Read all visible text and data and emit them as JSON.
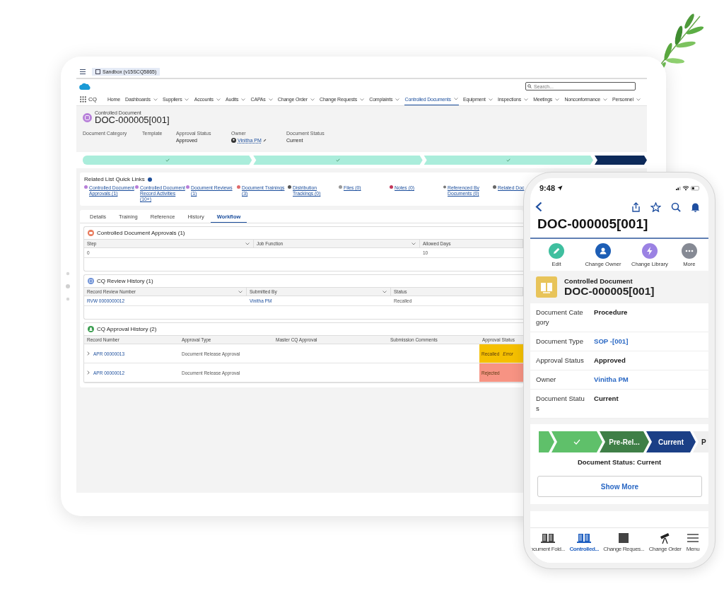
{
  "tablet": {
    "app_tab": "Sandbox (v15SCQ5865)",
    "app_name": "CQ",
    "search": {
      "placeholder": "Search..."
    },
    "nav": [
      {
        "label": "Home",
        "menu": false,
        "selected": false
      },
      {
        "label": "Dashboards",
        "menu": true,
        "selected": false
      },
      {
        "label": "Suppliers",
        "menu": true,
        "selected": false
      },
      {
        "label": "Accounts",
        "menu": true,
        "selected": false
      },
      {
        "label": "Audits",
        "menu": true,
        "selected": false
      },
      {
        "label": "CAPAs",
        "menu": true,
        "selected": false
      },
      {
        "label": "Change Order",
        "menu": true,
        "selected": false
      },
      {
        "label": "Change Requests",
        "menu": true,
        "selected": false
      },
      {
        "label": "Complaints",
        "menu": true,
        "selected": false
      },
      {
        "label": "Controlled Documents",
        "menu": true,
        "selected": true
      },
      {
        "label": "Equipment",
        "menu": true,
        "selected": false
      },
      {
        "label": "Inspections",
        "menu": true,
        "selected": false
      },
      {
        "label": "Meetings",
        "menu": true,
        "selected": false
      },
      {
        "label": "Nonconformance",
        "menu": true,
        "selected": false
      },
      {
        "label": "Personnel",
        "menu": true,
        "selected": false
      }
    ],
    "record": {
      "type": "Controlled Document",
      "title": "DOC-000005[001]",
      "fields": [
        {
          "label": "Document Category"
        },
        {
          "label": "Template"
        },
        {
          "label": "Approval Status",
          "value": "Approved",
          "kind": "text"
        },
        {
          "label": "Owner",
          "value": "Vinitha PM",
          "kind": "user"
        },
        {
          "label": "Document Status",
          "value": "Current",
          "kind": "text"
        }
      ]
    },
    "path": [
      {
        "selected": false
      },
      {
        "selected": false
      },
      {
        "selected": false
      },
      {
        "selected": true
      }
    ],
    "quick_links": {
      "title": "Related List Quick Links",
      "items": [
        {
          "label": "Controlled Document Approvals (1)",
          "color": "#b77fd9"
        },
        {
          "label": "Controlled Document Record Activities (10+)",
          "color": "#b77fd9"
        },
        {
          "label": "Document Reviews (1)",
          "color": "#b77fd9"
        },
        {
          "label": "Document Trainings (3)",
          "color": "#e06a6a"
        },
        {
          "label": "Distribution Trackings (0)",
          "color": "#555555"
        },
        {
          "label": "Files (0)",
          "color": "#999999"
        },
        {
          "label": "Notes (0)",
          "color": "#c2375a"
        },
        {
          "label": "Referenced By Documents (0)",
          "color": "#777777"
        },
        {
          "label": "Related Doc",
          "color": "#666666"
        }
      ]
    },
    "tabs": [
      {
        "label": "Details",
        "selected": false
      },
      {
        "label": "Training",
        "selected": false
      },
      {
        "label": "Reference",
        "selected": false
      },
      {
        "label": "History",
        "selected": false
      },
      {
        "label": "Workflow",
        "selected": true
      }
    ],
    "approvals": {
      "title": "Controlled Document Approvals (1)",
      "columns": [
        {
          "label": "Step",
          "menu": true
        },
        {
          "label": "Job Function",
          "menu": true
        },
        {
          "label": "Allowed Days",
          "menu": false
        }
      ],
      "rows": [
        {
          "step": "0",
          "allowed_days": "10"
        }
      ]
    },
    "review_history": {
      "title": "CQ Review History (1)",
      "columns": [
        {
          "label": "Record Review Number",
          "menu": true
        },
        {
          "label": "Submitted By",
          "menu": true
        },
        {
          "label": "Status",
          "menu": false
        }
      ],
      "rows": [
        {
          "number": "RVW 0000000012",
          "submitted_by": "Vinitha PM",
          "status": "Recalled"
        }
      ]
    },
    "approval_history": {
      "title": "CQ Approval History (2)",
      "columns": [
        "Record Number",
        "Approval Type",
        "Master CQ Approval",
        "Submission Comments",
        "Approval Status"
      ],
      "rows": [
        {
          "number": "APR 00000013",
          "type": "Document Release Approval",
          "status": "Recalled",
          "note": "Error",
          "color": "#f5c000"
        },
        {
          "number": "APR 00000012",
          "type": "Document Release Approval",
          "status": "Rejected",
          "color": "#f79383"
        }
      ]
    }
  },
  "phone": {
    "time": "9:48",
    "title": "DOC-000005[001]",
    "actions": [
      {
        "label": "Edit",
        "kind": "edit",
        "color": "#3fbf9f"
      },
      {
        "label": "Change Owner",
        "kind": "owner",
        "color": "#1d5eb5"
      },
      {
        "label": "Change Library",
        "kind": "bolt",
        "color": "#9b82e3"
      },
      {
        "label": "More",
        "kind": "more",
        "color": "#868a94"
      }
    ],
    "header": {
      "type": "Controlled Document",
      "title": "DOC-000005[001]"
    },
    "fields": [
      {
        "label": "Document Category",
        "value": "Procedure",
        "link": false
      },
      {
        "label": "Document Type",
        "value": "SOP -[001]",
        "link": true
      },
      {
        "label": "Approval Status",
        "value": "Approved",
        "link": false
      },
      {
        "label": "Owner",
        "value": "Vinitha PM",
        "link": true
      },
      {
        "label": "Document Status",
        "value": "Current",
        "link": false
      }
    ],
    "path": [
      {
        "kind": "complete"
      },
      {
        "kind": "complete"
      },
      {
        "label": "Pre-Rel...",
        "kind": "done"
      },
      {
        "label": "Current",
        "kind": "current"
      },
      {
        "label": "P",
        "kind": "upcoming"
      }
    ],
    "path_caption": "Document Status: Current",
    "show_more": "Show More",
    "tab_bar": [
      {
        "label": "ocument Fold...",
        "kind": "book",
        "selected": false
      },
      {
        "label": "Controlled...",
        "kind": "book",
        "selected": true
      },
      {
        "label": "Change Reques...",
        "kind": "square",
        "selected": false
      },
      {
        "label": "Change Order",
        "kind": "telescope",
        "selected": false
      },
      {
        "label": "Menu",
        "kind": "menu",
        "selected": false
      }
    ]
  }
}
